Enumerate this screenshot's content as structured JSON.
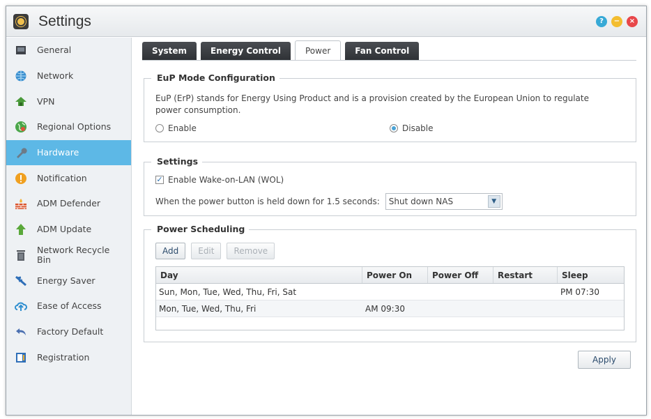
{
  "window": {
    "title": "Settings"
  },
  "controls": {
    "help": "?",
    "minimize": "−",
    "close": "×"
  },
  "sidebar": {
    "items": [
      {
        "label": "General",
        "icon": "general-icon",
        "active": false
      },
      {
        "label": "Network",
        "icon": "globe-icon",
        "active": false
      },
      {
        "label": "VPN",
        "icon": "vpn-icon",
        "active": false
      },
      {
        "label": "Regional Options",
        "icon": "regional-icon",
        "active": false
      },
      {
        "label": "Hardware",
        "icon": "wrench-icon",
        "active": true
      },
      {
        "label": "Notification",
        "icon": "exclamation-icon",
        "active": false
      },
      {
        "label": "ADM Defender",
        "icon": "firewall-icon",
        "active": false
      },
      {
        "label": "ADM Update",
        "icon": "update-arrow-icon",
        "active": false
      },
      {
        "label": "Network Recycle Bin",
        "icon": "trash-icon",
        "active": false
      },
      {
        "label": "Energy Saver",
        "icon": "energy-icon",
        "active": false
      },
      {
        "label": "Ease of Access",
        "icon": "cloud-access-icon",
        "active": false
      },
      {
        "label": "Factory Default",
        "icon": "undo-arrow-icon",
        "active": false
      },
      {
        "label": "Registration",
        "icon": "registration-icon",
        "active": false
      }
    ]
  },
  "tabs": [
    {
      "label": "System",
      "active": false
    },
    {
      "label": "Energy Control",
      "active": false
    },
    {
      "label": "Power",
      "active": true
    },
    {
      "label": "Fan Control",
      "active": false
    }
  ],
  "eup": {
    "legend": "EuP Mode Configuration",
    "description": "EuP (ErP) stands for Energy Using Product and is a provision created by the European Union to regulate power consumption.",
    "enable_label": "Enable",
    "disable_label": "Disable",
    "selected": "Disable"
  },
  "settings": {
    "legend": "Settings",
    "wol_label": "Enable Wake-on-LAN (WOL)",
    "wol_checked": true,
    "power_button_label": "When the power button is held down for 1.5 seconds:",
    "power_button_value": "Shut down NAS"
  },
  "scheduling": {
    "legend": "Power Scheduling",
    "add_label": "Add",
    "edit_label": "Edit",
    "remove_label": "Remove",
    "columns": [
      "Day",
      "Power On",
      "Power Off",
      "Restart",
      "Sleep"
    ],
    "rows": [
      {
        "day": "Sun, Mon, Tue, Wed, Thu, Fri, Sat",
        "power_on": "",
        "power_off": "",
        "restart": "",
        "sleep": "PM 07:30"
      },
      {
        "day": "Mon, Tue, Wed, Thu, Fri",
        "power_on": "AM 09:30",
        "power_off": "",
        "restart": "",
        "sleep": ""
      }
    ]
  },
  "footer": {
    "apply_label": "Apply"
  },
  "colors": {
    "accent": "#5db8e6",
    "tab_dark": "#3a3d42"
  }
}
